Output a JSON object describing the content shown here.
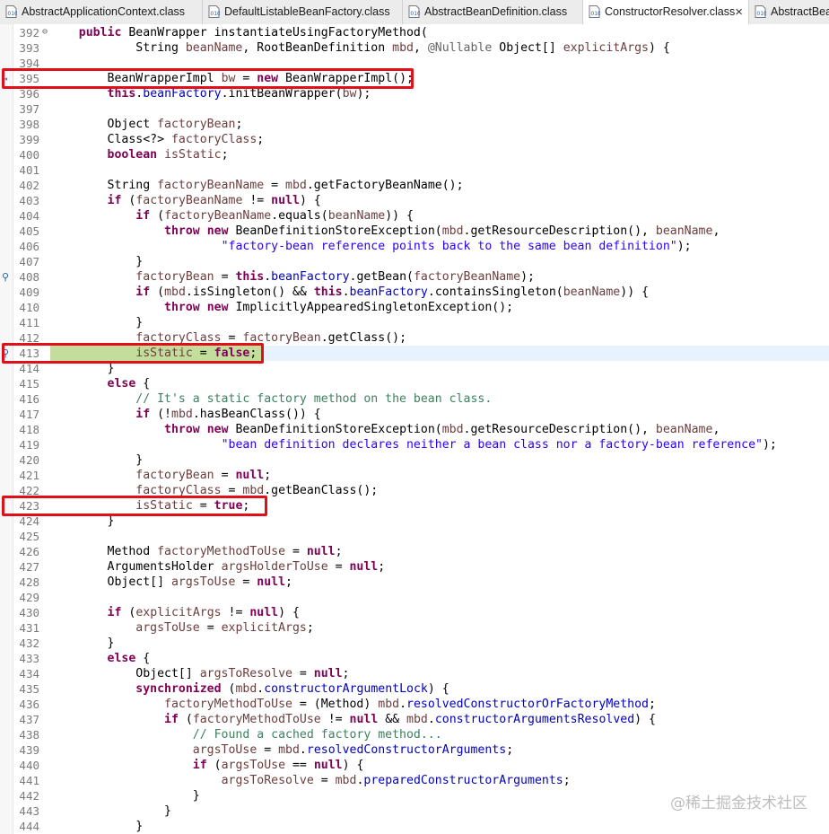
{
  "tabs": [
    {
      "label": "AbstractApplicationContext.class",
      "active": false,
      "closable": false
    },
    {
      "label": "DefaultListableBeanFactory.class",
      "active": false,
      "closable": false
    },
    {
      "label": "AbstractBeanDefinition.class",
      "active": false,
      "closable": false
    },
    {
      "label": "ConstructorResolver.class",
      "active": true,
      "closable": true
    },
    {
      "label": "AbstractBea",
      "active": false,
      "closable": false
    }
  ],
  "close_glyph": "×",
  "editor": {
    "highlighted_line": "413",
    "lines": [
      {
        "n": "392",
        "fold": true,
        "toks": [
          [
            "",
            "\t"
          ],
          [
            "kw",
            "public"
          ],
          [
            "",
            " BeanWrapper instantiateUsingFactoryMethod("
          ]
        ]
      },
      {
        "n": "393",
        "toks": [
          [
            "",
            "\t\t\tString "
          ],
          [
            "var",
            "beanName"
          ],
          [
            "",
            ", RootBeanDefinition "
          ],
          [
            "var",
            "mbd"
          ],
          [
            "",
            ", "
          ],
          [
            "ann",
            "@Nullable"
          ],
          [
            "",
            " Object[] "
          ],
          [
            "var",
            "explicitArgs"
          ],
          [
            "",
            ") {"
          ]
        ]
      },
      {
        "n": "394",
        "toks": []
      },
      {
        "n": "395",
        "gutter": "arrow",
        "toks": [
          [
            "",
            "\t\tBeanWrapperImpl "
          ],
          [
            "var",
            "bw"
          ],
          [
            "",
            " = "
          ],
          [
            "kw",
            "new"
          ],
          [
            "",
            " BeanWrapperImpl();"
          ]
        ]
      },
      {
        "n": "396",
        "toks": [
          [
            "",
            "\t\t"
          ],
          [
            "kw",
            "this"
          ],
          [
            "",
            "."
          ],
          [
            "fld",
            "beanFactory"
          ],
          [
            "",
            ".initBeanWrapper("
          ],
          [
            "var",
            "bw"
          ],
          [
            "",
            ");"
          ]
        ]
      },
      {
        "n": "397",
        "toks": []
      },
      {
        "n": "398",
        "toks": [
          [
            "",
            "\t\tObject "
          ],
          [
            "var",
            "factoryBean"
          ],
          [
            "",
            ";"
          ]
        ]
      },
      {
        "n": "399",
        "toks": [
          [
            "",
            "\t\tClass<?> "
          ],
          [
            "var",
            "factoryClass"
          ],
          [
            "",
            ";"
          ]
        ]
      },
      {
        "n": "400",
        "toks": [
          [
            "",
            "\t\t"
          ],
          [
            "kw",
            "boolean"
          ],
          [
            "",
            " "
          ],
          [
            "var",
            "isStatic"
          ],
          [
            "",
            ";"
          ]
        ]
      },
      {
        "n": "401",
        "toks": []
      },
      {
        "n": "402",
        "toks": [
          [
            "",
            "\t\tString "
          ],
          [
            "var",
            "factoryBeanName"
          ],
          [
            "",
            " = "
          ],
          [
            "var",
            "mbd"
          ],
          [
            "",
            ".getFactoryBeanName();"
          ]
        ]
      },
      {
        "n": "403",
        "toks": [
          [
            "",
            "\t\t"
          ],
          [
            "kw",
            "if"
          ],
          [
            "",
            " ("
          ],
          [
            "var",
            "factoryBeanName"
          ],
          [
            "",
            " != "
          ],
          [
            "kw",
            "null"
          ],
          [
            "",
            ") {"
          ]
        ]
      },
      {
        "n": "404",
        "toks": [
          [
            "",
            "\t\t\t"
          ],
          [
            "kw",
            "if"
          ],
          [
            "",
            " ("
          ],
          [
            "var",
            "factoryBeanName"
          ],
          [
            "",
            ".equals("
          ],
          [
            "var",
            "beanName"
          ],
          [
            "",
            ")) {"
          ]
        ]
      },
      {
        "n": "405",
        "toks": [
          [
            "",
            "\t\t\t\t"
          ],
          [
            "kw",
            "throw"
          ],
          [
            "",
            " "
          ],
          [
            "kw",
            "new"
          ],
          [
            "",
            " BeanDefinitionStoreException("
          ],
          [
            "var",
            "mbd"
          ],
          [
            "",
            ".getResourceDescription(), "
          ],
          [
            "var",
            "beanName"
          ],
          [
            "",
            ","
          ]
        ]
      },
      {
        "n": "406",
        "toks": [
          [
            "",
            "\t\t\t\t\t\t"
          ],
          [
            "str",
            "\"factory-bean reference points back to the same bean definition\""
          ],
          [
            "",
            ");"
          ]
        ]
      },
      {
        "n": "407",
        "toks": [
          [
            "",
            "\t\t\t}"
          ]
        ]
      },
      {
        "n": "408",
        "gutter": "bp",
        "toks": [
          [
            "",
            "\t\t\t"
          ],
          [
            "var",
            "factoryBean"
          ],
          [
            "",
            " = "
          ],
          [
            "kw",
            "this"
          ],
          [
            "",
            "."
          ],
          [
            "fld",
            "beanFactory"
          ],
          [
            "",
            ".getBean("
          ],
          [
            "var",
            "factoryBeanName"
          ],
          [
            "",
            ");"
          ]
        ]
      },
      {
        "n": "409",
        "toks": [
          [
            "",
            "\t\t\t"
          ],
          [
            "kw",
            "if"
          ],
          [
            "",
            " ("
          ],
          [
            "var",
            "mbd"
          ],
          [
            "",
            ".isSingleton() && "
          ],
          [
            "kw",
            "this"
          ],
          [
            "",
            "."
          ],
          [
            "fld",
            "beanFactory"
          ],
          [
            "",
            ".containsSingleton("
          ],
          [
            "var",
            "beanName"
          ],
          [
            "",
            ")) {"
          ]
        ]
      },
      {
        "n": "410",
        "toks": [
          [
            "",
            "\t\t\t\t"
          ],
          [
            "kw",
            "throw"
          ],
          [
            "",
            " "
          ],
          [
            "kw",
            "new"
          ],
          [
            "",
            " ImplicitlyAppearedSingletonException();"
          ]
        ]
      },
      {
        "n": "411",
        "toks": [
          [
            "",
            "\t\t\t}"
          ]
        ]
      },
      {
        "n": "412",
        "toks": [
          [
            "",
            "\t\t\t"
          ],
          [
            "var",
            "factoryClass"
          ],
          [
            "",
            " = "
          ],
          [
            "var",
            "factoryBean"
          ],
          [
            "",
            ".getClass();"
          ]
        ]
      },
      {
        "n": "413",
        "gutter": "bp",
        "exec": true,
        "toks": [
          [
            "",
            "\t\t\t"
          ],
          [
            "var",
            "isStatic"
          ],
          [
            "",
            " = "
          ],
          [
            "kw",
            "false"
          ],
          [
            "",
            ";"
          ]
        ]
      },
      {
        "n": "414",
        "toks": [
          [
            "",
            "\t\t}"
          ]
        ]
      },
      {
        "n": "415",
        "toks": [
          [
            "",
            "\t\t"
          ],
          [
            "kw",
            "else"
          ],
          [
            "",
            " {"
          ]
        ]
      },
      {
        "n": "416",
        "toks": [
          [
            "",
            "\t\t\t"
          ],
          [
            "cmt",
            "// It's a static factory method on the bean class."
          ]
        ]
      },
      {
        "n": "417",
        "toks": [
          [
            "",
            "\t\t\t"
          ],
          [
            "kw",
            "if"
          ],
          [
            "",
            " (!"
          ],
          [
            "var",
            "mbd"
          ],
          [
            "",
            ".hasBeanClass()) {"
          ]
        ]
      },
      {
        "n": "418",
        "toks": [
          [
            "",
            "\t\t\t\t"
          ],
          [
            "kw",
            "throw"
          ],
          [
            "",
            " "
          ],
          [
            "kw",
            "new"
          ],
          [
            "",
            " BeanDefinitionStoreException("
          ],
          [
            "var",
            "mbd"
          ],
          [
            "",
            ".getResourceDescription(), "
          ],
          [
            "var",
            "beanName"
          ],
          [
            "",
            ","
          ]
        ]
      },
      {
        "n": "419",
        "toks": [
          [
            "",
            "\t\t\t\t\t\t"
          ],
          [
            "str",
            "\"bean definition declares neither a bean class nor a factory-bean reference\""
          ],
          [
            "",
            ");"
          ]
        ]
      },
      {
        "n": "420",
        "toks": [
          [
            "",
            "\t\t\t}"
          ]
        ]
      },
      {
        "n": "421",
        "toks": [
          [
            "",
            "\t\t\t"
          ],
          [
            "var",
            "factoryBean"
          ],
          [
            "",
            " = "
          ],
          [
            "kw",
            "null"
          ],
          [
            "",
            ";"
          ]
        ]
      },
      {
        "n": "422",
        "toks": [
          [
            "",
            "\t\t\t"
          ],
          [
            "var",
            "factoryClass"
          ],
          [
            "",
            " = "
          ],
          [
            "var",
            "mbd"
          ],
          [
            "",
            ".getBeanClass();"
          ]
        ]
      },
      {
        "n": "423",
        "toks": [
          [
            "",
            "\t\t\t"
          ],
          [
            "var",
            "isStatic"
          ],
          [
            "",
            " = "
          ],
          [
            "kw",
            "true"
          ],
          [
            "",
            ";"
          ]
        ]
      },
      {
        "n": "424",
        "toks": [
          [
            "",
            "\t\t}"
          ]
        ]
      },
      {
        "n": "425",
        "toks": []
      },
      {
        "n": "426",
        "toks": [
          [
            "",
            "\t\tMethod "
          ],
          [
            "var",
            "factoryMethodToUse"
          ],
          [
            "",
            " = "
          ],
          [
            "kw",
            "null"
          ],
          [
            "",
            ";"
          ]
        ]
      },
      {
        "n": "427",
        "toks": [
          [
            "",
            "\t\tArgumentsHolder "
          ],
          [
            "var",
            "argsHolderToUse"
          ],
          [
            "",
            " = "
          ],
          [
            "kw",
            "null"
          ],
          [
            "",
            ";"
          ]
        ]
      },
      {
        "n": "428",
        "toks": [
          [
            "",
            "\t\tObject[] "
          ],
          [
            "var",
            "argsToUse"
          ],
          [
            "",
            " = "
          ],
          [
            "kw",
            "null"
          ],
          [
            "",
            ";"
          ]
        ]
      },
      {
        "n": "429",
        "toks": []
      },
      {
        "n": "430",
        "toks": [
          [
            "",
            "\t\t"
          ],
          [
            "kw",
            "if"
          ],
          [
            "",
            " ("
          ],
          [
            "var",
            "explicitArgs"
          ],
          [
            "",
            " != "
          ],
          [
            "kw",
            "null"
          ],
          [
            "",
            ") {"
          ]
        ]
      },
      {
        "n": "431",
        "toks": [
          [
            "",
            "\t\t\t"
          ],
          [
            "var",
            "argsToUse"
          ],
          [
            "",
            " = "
          ],
          [
            "var",
            "explicitArgs"
          ],
          [
            "",
            ";"
          ]
        ]
      },
      {
        "n": "432",
        "toks": [
          [
            "",
            "\t\t}"
          ]
        ]
      },
      {
        "n": "433",
        "toks": [
          [
            "",
            "\t\t"
          ],
          [
            "kw",
            "else"
          ],
          [
            "",
            " {"
          ]
        ]
      },
      {
        "n": "434",
        "toks": [
          [
            "",
            "\t\t\tObject[] "
          ],
          [
            "var",
            "argsToResolve"
          ],
          [
            "",
            " = "
          ],
          [
            "kw",
            "null"
          ],
          [
            "",
            ";"
          ]
        ]
      },
      {
        "n": "435",
        "toks": [
          [
            "",
            "\t\t\t"
          ],
          [
            "kw",
            "synchronized"
          ],
          [
            "",
            " ("
          ],
          [
            "var",
            "mbd"
          ],
          [
            "",
            "."
          ],
          [
            "fld",
            "constructorArgumentLock"
          ],
          [
            "",
            ") {"
          ]
        ]
      },
      {
        "n": "436",
        "toks": [
          [
            "",
            "\t\t\t\t"
          ],
          [
            "var",
            "factoryMethodToUse"
          ],
          [
            "",
            " = (Method) "
          ],
          [
            "var",
            "mbd"
          ],
          [
            "",
            "."
          ],
          [
            "fld",
            "resolvedConstructorOrFactoryMethod"
          ],
          [
            "",
            ";"
          ]
        ]
      },
      {
        "n": "437",
        "toks": [
          [
            "",
            "\t\t\t\t"
          ],
          [
            "kw",
            "if"
          ],
          [
            "",
            " ("
          ],
          [
            "var",
            "factoryMethodToUse"
          ],
          [
            "",
            " != "
          ],
          [
            "kw",
            "null"
          ],
          [
            "",
            " && "
          ],
          [
            "var",
            "mbd"
          ],
          [
            "",
            "."
          ],
          [
            "fld",
            "constructorArgumentsResolved"
          ],
          [
            "",
            ") {"
          ]
        ]
      },
      {
        "n": "438",
        "toks": [
          [
            "",
            "\t\t\t\t\t"
          ],
          [
            "cmt",
            "// Found a cached factory method..."
          ]
        ]
      },
      {
        "n": "439",
        "toks": [
          [
            "",
            "\t\t\t\t\t"
          ],
          [
            "var",
            "argsToUse"
          ],
          [
            "",
            " = "
          ],
          [
            "var",
            "mbd"
          ],
          [
            "",
            "."
          ],
          [
            "fld",
            "resolvedConstructorArguments"
          ],
          [
            "",
            ";"
          ]
        ]
      },
      {
        "n": "440",
        "toks": [
          [
            "",
            "\t\t\t\t\t"
          ],
          [
            "kw",
            "if"
          ],
          [
            "",
            " ("
          ],
          [
            "var",
            "argsToUse"
          ],
          [
            "",
            " == "
          ],
          [
            "kw",
            "null"
          ],
          [
            "",
            ") {"
          ]
        ]
      },
      {
        "n": "441",
        "toks": [
          [
            "",
            "\t\t\t\t\t\t"
          ],
          [
            "var",
            "argsToResolve"
          ],
          [
            "",
            " = "
          ],
          [
            "var",
            "mbd"
          ],
          [
            "",
            "."
          ],
          [
            "fld",
            "preparedConstructorArguments"
          ],
          [
            "",
            ";"
          ]
        ]
      },
      {
        "n": "442",
        "toks": [
          [
            "",
            "\t\t\t\t\t}"
          ]
        ]
      },
      {
        "n": "443",
        "toks": [
          [
            "",
            "\t\t\t\t}"
          ]
        ]
      },
      {
        "n": "444",
        "toks": [
          [
            "",
            "\t\t\t}"
          ]
        ]
      }
    ]
  },
  "annotations": [
    {
      "line": "395",
      "color": "#e0101a"
    },
    {
      "line": "413",
      "color": "#e0101a"
    },
    {
      "line": "423",
      "color": "#e0101a"
    }
  ],
  "watermark": "@稀土掘金技术社区"
}
